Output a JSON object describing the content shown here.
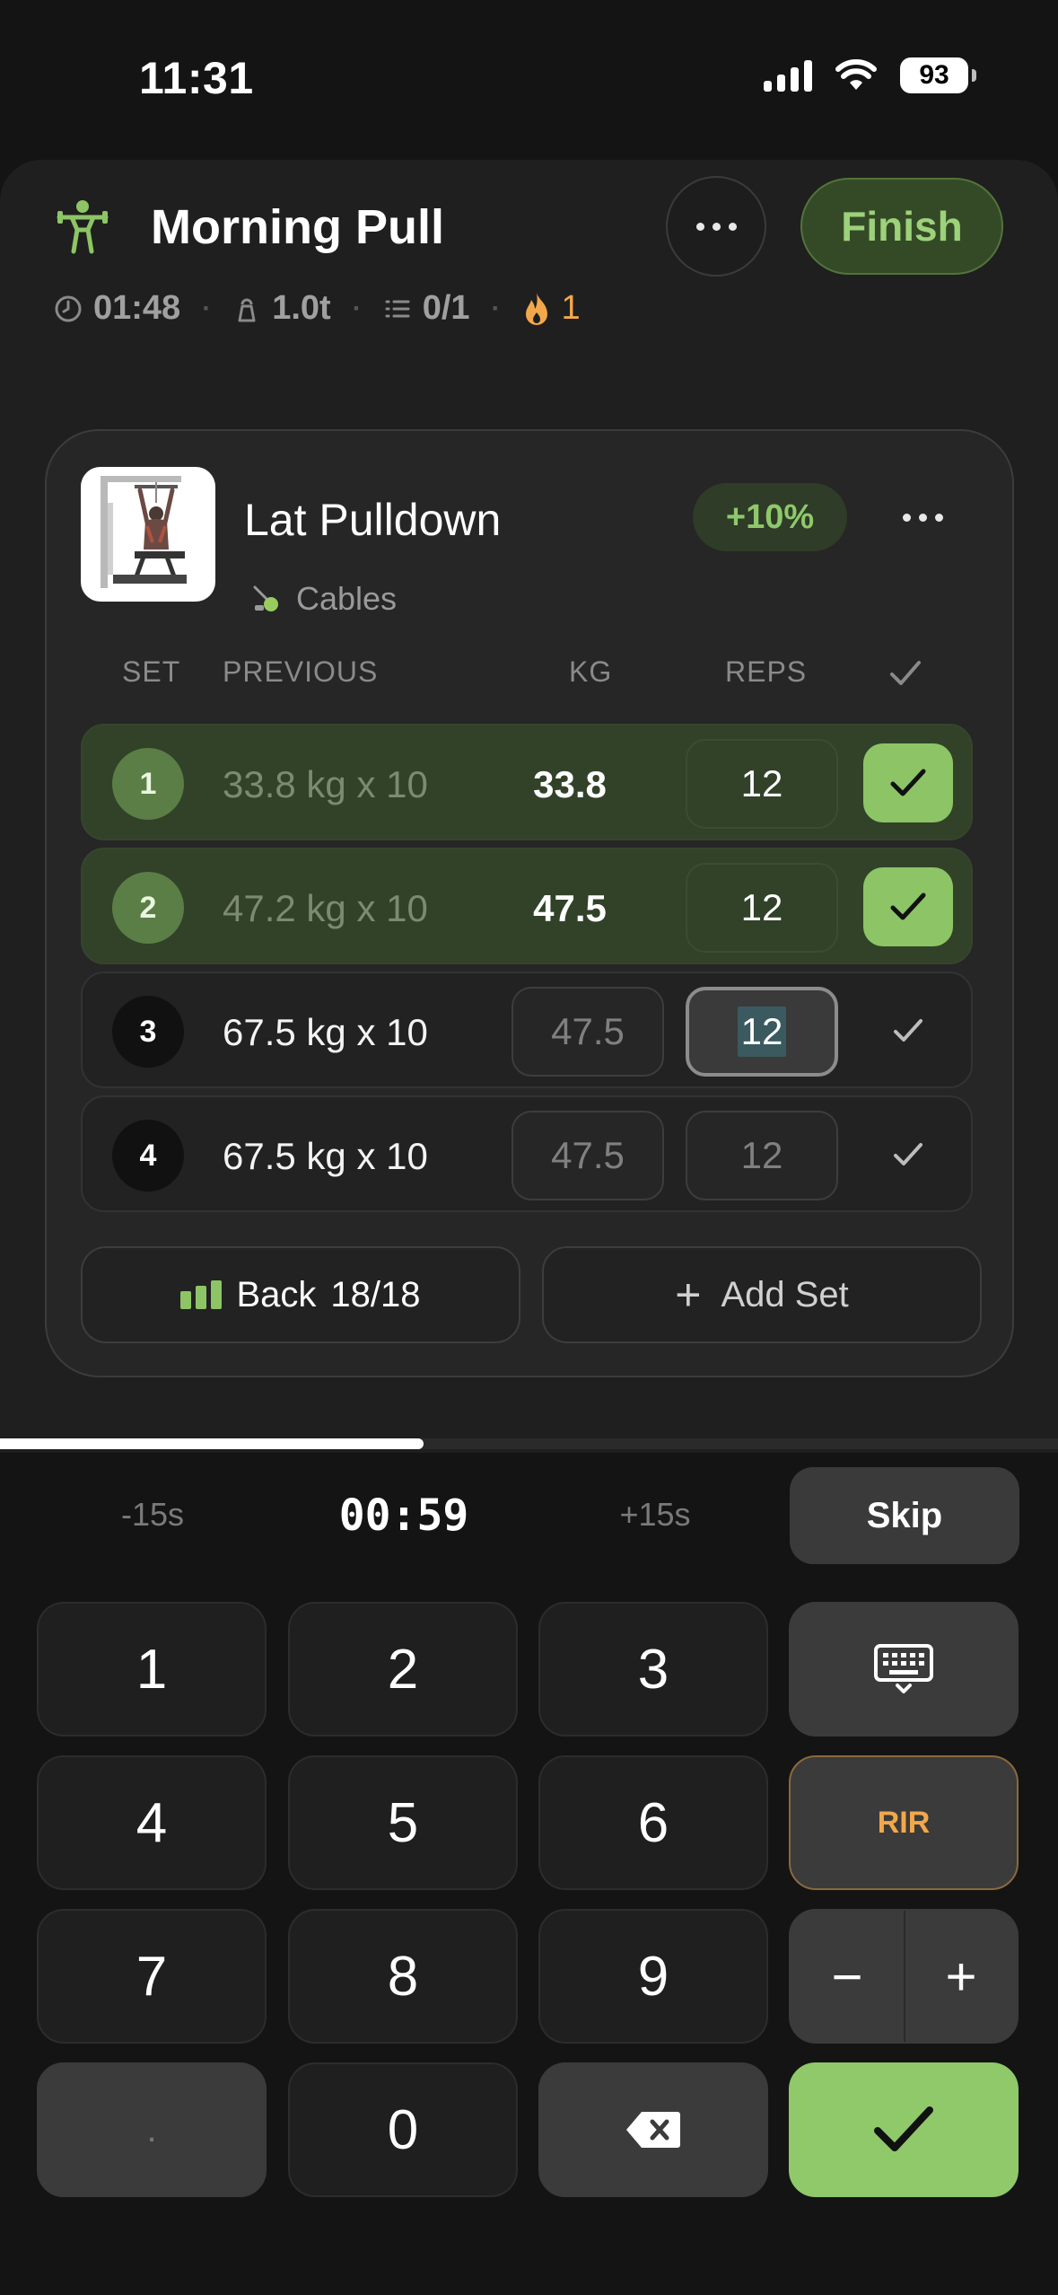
{
  "status_bar": {
    "time": "11:31",
    "battery": "93"
  },
  "workout": {
    "title": "Morning Pull",
    "finish_label": "Finish",
    "stats": {
      "duration": "01:48",
      "volume": "1.0t",
      "exercises": "0/1",
      "streak": "1"
    }
  },
  "exercise": {
    "name": "Lat Pulldown",
    "equipment": "Cables",
    "progress_badge": "+10%",
    "columns": {
      "set": "SET",
      "previous": "PREVIOUS",
      "kg": "KG",
      "reps": "REPS"
    },
    "sets": [
      {
        "num": "1",
        "previous": "33.8 kg x 10",
        "kg": "33.8",
        "reps": "12",
        "done": true
      },
      {
        "num": "2",
        "previous": "47.2 kg x 10",
        "kg": "47.5",
        "reps": "12",
        "done": true
      },
      {
        "num": "3",
        "previous": "67.5 kg x 10",
        "kg": "47.5",
        "reps": "12",
        "done": false
      },
      {
        "num": "4",
        "previous": "67.5 kg x 10",
        "kg": "47.5",
        "reps": "12",
        "done": false
      }
    ],
    "muscle_label": "Back",
    "muscle_count": "18/18",
    "add_set_label": "Add Set"
  },
  "rest_timer": {
    "minus_label": "-15s",
    "time": "00:59",
    "plus_label": "+15s",
    "skip_label": "Skip",
    "progress_fraction": 0.4
  },
  "keypad": {
    "keys": [
      "1",
      "2",
      "3",
      "4",
      "5",
      "6",
      "7",
      "8",
      "9",
      ".",
      "0"
    ],
    "rir_label": "RIR",
    "minus": "−",
    "plus": "+"
  },
  "colors": {
    "accent_green": "#8fc96a",
    "accent_orange": "#f2a84a",
    "background": "#141414"
  },
  "icons": [
    "clock-icon",
    "kettlebell-icon",
    "list-icon",
    "flame-icon",
    "workout-person-icon",
    "cable-icon",
    "keyboard-icon",
    "backspace-icon",
    "check-icon"
  ]
}
